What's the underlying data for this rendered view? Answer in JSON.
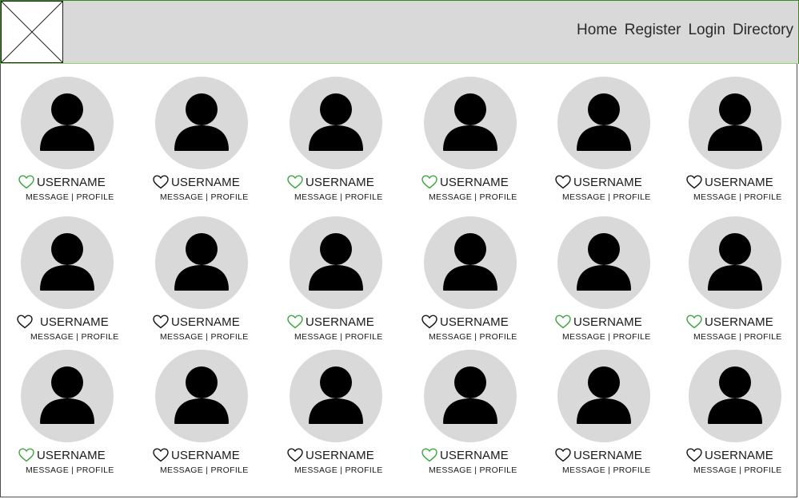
{
  "nav": {
    "home": "Home",
    "register": "Register",
    "login": "Login",
    "directory": "Directory"
  },
  "colors": {
    "header_bg": "#d9d9d9",
    "avatar_bg": "#d9d9d9",
    "heart_active": "#3aa63a",
    "heart_inactive": "#111111"
  },
  "users": [
    {
      "username": "USERNAME",
      "message": "MESSAGE",
      "profile": "PROFILE",
      "liked": true
    },
    {
      "username": "USERNAME",
      "message": "MESSAGE",
      "profile": "PROFILE",
      "liked": false
    },
    {
      "username": "USERNAME",
      "message": "MESSAGE",
      "profile": "PROFILE",
      "liked": true
    },
    {
      "username": "USERNAME",
      "message": "MESSAGE",
      "profile": "PROFILE",
      "liked": true
    },
    {
      "username": "USERNAME",
      "message": "MESSAGE",
      "profile": "PROFILE",
      "liked": false
    },
    {
      "username": "USERNAME",
      "message": "MESSAGE",
      "profile": "PROFILE",
      "liked": false
    },
    {
      "username": "USERNAME",
      "message": "MESSAGE",
      "profile": "PROFILE",
      "liked": false
    },
    {
      "username": "USERNAME",
      "message": "MESSAGE",
      "profile": "PROFILE",
      "liked": false
    },
    {
      "username": "USERNAME",
      "message": "MESSAGE",
      "profile": "PROFILE",
      "liked": true
    },
    {
      "username": "USERNAME",
      "message": "MESSAGE",
      "profile": "PROFILE",
      "liked": false
    },
    {
      "username": "USERNAME",
      "message": "MESSAGE",
      "profile": "PROFILE",
      "liked": true
    },
    {
      "username": "USERNAME",
      "message": "MESSAGE",
      "profile": "PROFILE",
      "liked": true
    },
    {
      "username": "USERNAME",
      "message": "MESSAGE",
      "profile": "PROFILE",
      "liked": true
    },
    {
      "username": "USERNAME",
      "message": "MESSAGE",
      "profile": "PROFILE",
      "liked": false
    },
    {
      "username": "USERNAME",
      "message": "MESSAGE",
      "profile": "PROFILE",
      "liked": false
    },
    {
      "username": "USERNAME",
      "message": "MESSAGE",
      "profile": "PROFILE",
      "liked": true
    },
    {
      "username": "USERNAME",
      "message": "MESSAGE",
      "profile": "PROFILE",
      "liked": false
    },
    {
      "username": "USERNAME",
      "message": "MESSAGE",
      "profile": "PROFILE",
      "liked": false
    }
  ]
}
